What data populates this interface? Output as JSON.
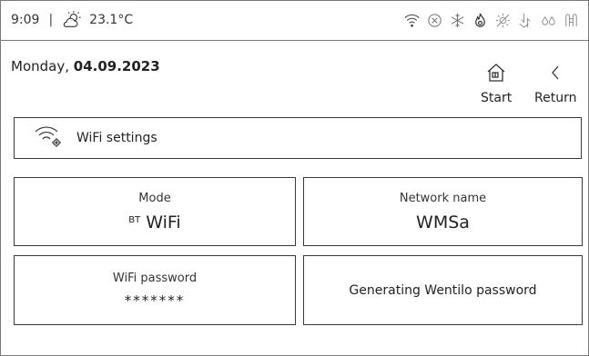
{
  "status": {
    "time": "9:09",
    "separator": "|",
    "temperature": "23.1°C",
    "icons": [
      "partly-sunny-icon",
      "wifi-icon",
      "cancel-circle-icon",
      "snowflake-icon",
      "flame-icon",
      "sun-off-icon",
      "airflow-icon",
      "drops-icon",
      "filter-icon"
    ]
  },
  "header": {
    "date_day": "Monday, ",
    "date_value": "04.09.2023",
    "start_label": "Start",
    "return_label": "Return"
  },
  "section": {
    "title": "WiFi settings"
  },
  "tiles": {
    "mode_label": "Mode",
    "mode_prefix": "BT",
    "mode_value": "WiFi",
    "network_label": "Network name",
    "network_value": "WMSa",
    "password_label": "WiFi password",
    "password_value": "*******",
    "generate_label": "Generating Wentilo password"
  }
}
